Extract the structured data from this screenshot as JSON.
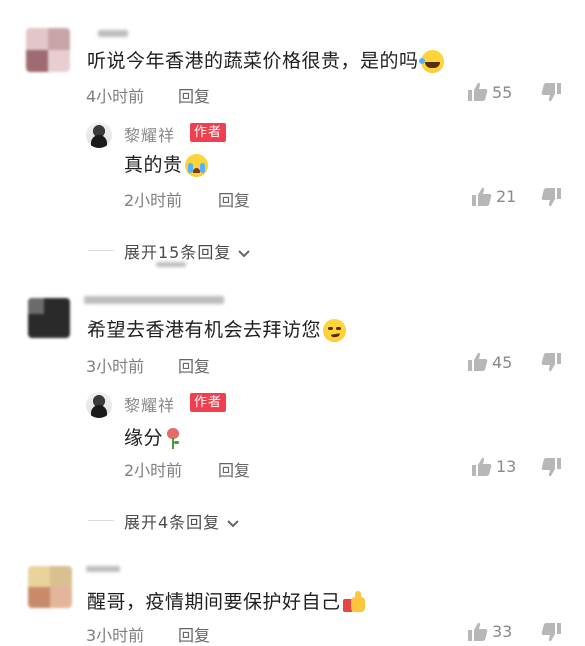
{
  "comments": [
    {
      "text": "听说今年香港的蔬菜价格很贵，是的吗",
      "time": "4小时前",
      "reply_label": "回复",
      "likes": "55",
      "reply": {
        "author": "黎耀祥",
        "badge": "作者",
        "text": "真的贵",
        "time": "2小时前",
        "reply_label": "回复",
        "likes": "21"
      },
      "expand": "展开15条回复"
    },
    {
      "text": "希望去香港有机会去拜访您",
      "time": "3小时前",
      "reply_label": "回复",
      "likes": "45",
      "reply": {
        "author": "黎耀祥",
        "badge": "作者",
        "text": "缘分",
        "time": "2小时前",
        "reply_label": "回复",
        "likes": "13"
      },
      "expand": "展开4条回复"
    },
    {
      "text": "醒哥，疫情期间要保护好自己",
      "time": "3小时前",
      "reply_label": "回复",
      "likes": "33"
    }
  ],
  "icons": {
    "like": "thumbs-up-icon",
    "dislike": "thumbs-down-icon",
    "expand": "chevron-down-icon"
  },
  "colors": {
    "badge": "#f0404f",
    "meta_text": "#7f7f7f"
  }
}
